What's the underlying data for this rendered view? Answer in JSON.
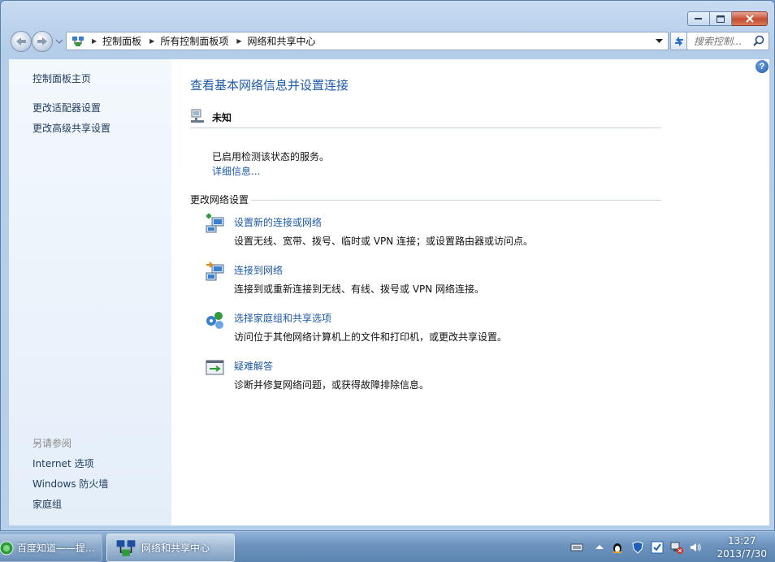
{
  "window": {
    "caption_buttons": {
      "minimize": "minimize-icon",
      "maximize": "maximize-icon",
      "close": "close-icon"
    }
  },
  "nav": {
    "breadcrumbs": [
      "控制面板",
      "所有控制面板项",
      "网络和共享中心"
    ],
    "search_placeholder": "搜索控制..."
  },
  "sidebar": {
    "home": "控制面板主页",
    "links": [
      "更改适配器设置",
      "更改高级共享设置"
    ],
    "see_also_title": "另请参阅",
    "see_also": [
      "Internet 选项",
      "Windows 防火墙",
      "家庭组"
    ]
  },
  "main": {
    "title": "查看基本网络信息并设置连接",
    "network_name": "未知",
    "status_text": "已启用检测该状态的服务。",
    "details_link": "详细信息...",
    "section_title": "更改网络设置",
    "tasks": [
      {
        "title": "设置新的连接或网络",
        "desc": "设置无线、宽带、拨号、临时或 VPN 连接；或设置路由器或访问点。",
        "icon": "new-connection-icon"
      },
      {
        "title": "连接到网络",
        "desc": "连接到或重新连接到无线、有线、拨号或 VPN 网络连接。",
        "icon": "connect-network-icon"
      },
      {
        "title": "选择家庭组和共享选项",
        "desc": "访问位于其他网络计算机上的文件和打印机，或更改共享设置。",
        "icon": "homegroup-icon"
      },
      {
        "title": "疑难解答",
        "desc": "诊断并修复网络问题，或获得故障排除信息。",
        "icon": "troubleshoot-icon"
      }
    ]
  },
  "taskbar": {
    "items": [
      {
        "label": "百度知道——提..."
      },
      {
        "label": "网络和共享中心"
      }
    ],
    "time": "13:27",
    "date": "2013/7/30"
  },
  "colors": {
    "link": "#1e5aa8",
    "sidebar_link": "#1e395b",
    "taskbar": "#6d93bd"
  }
}
